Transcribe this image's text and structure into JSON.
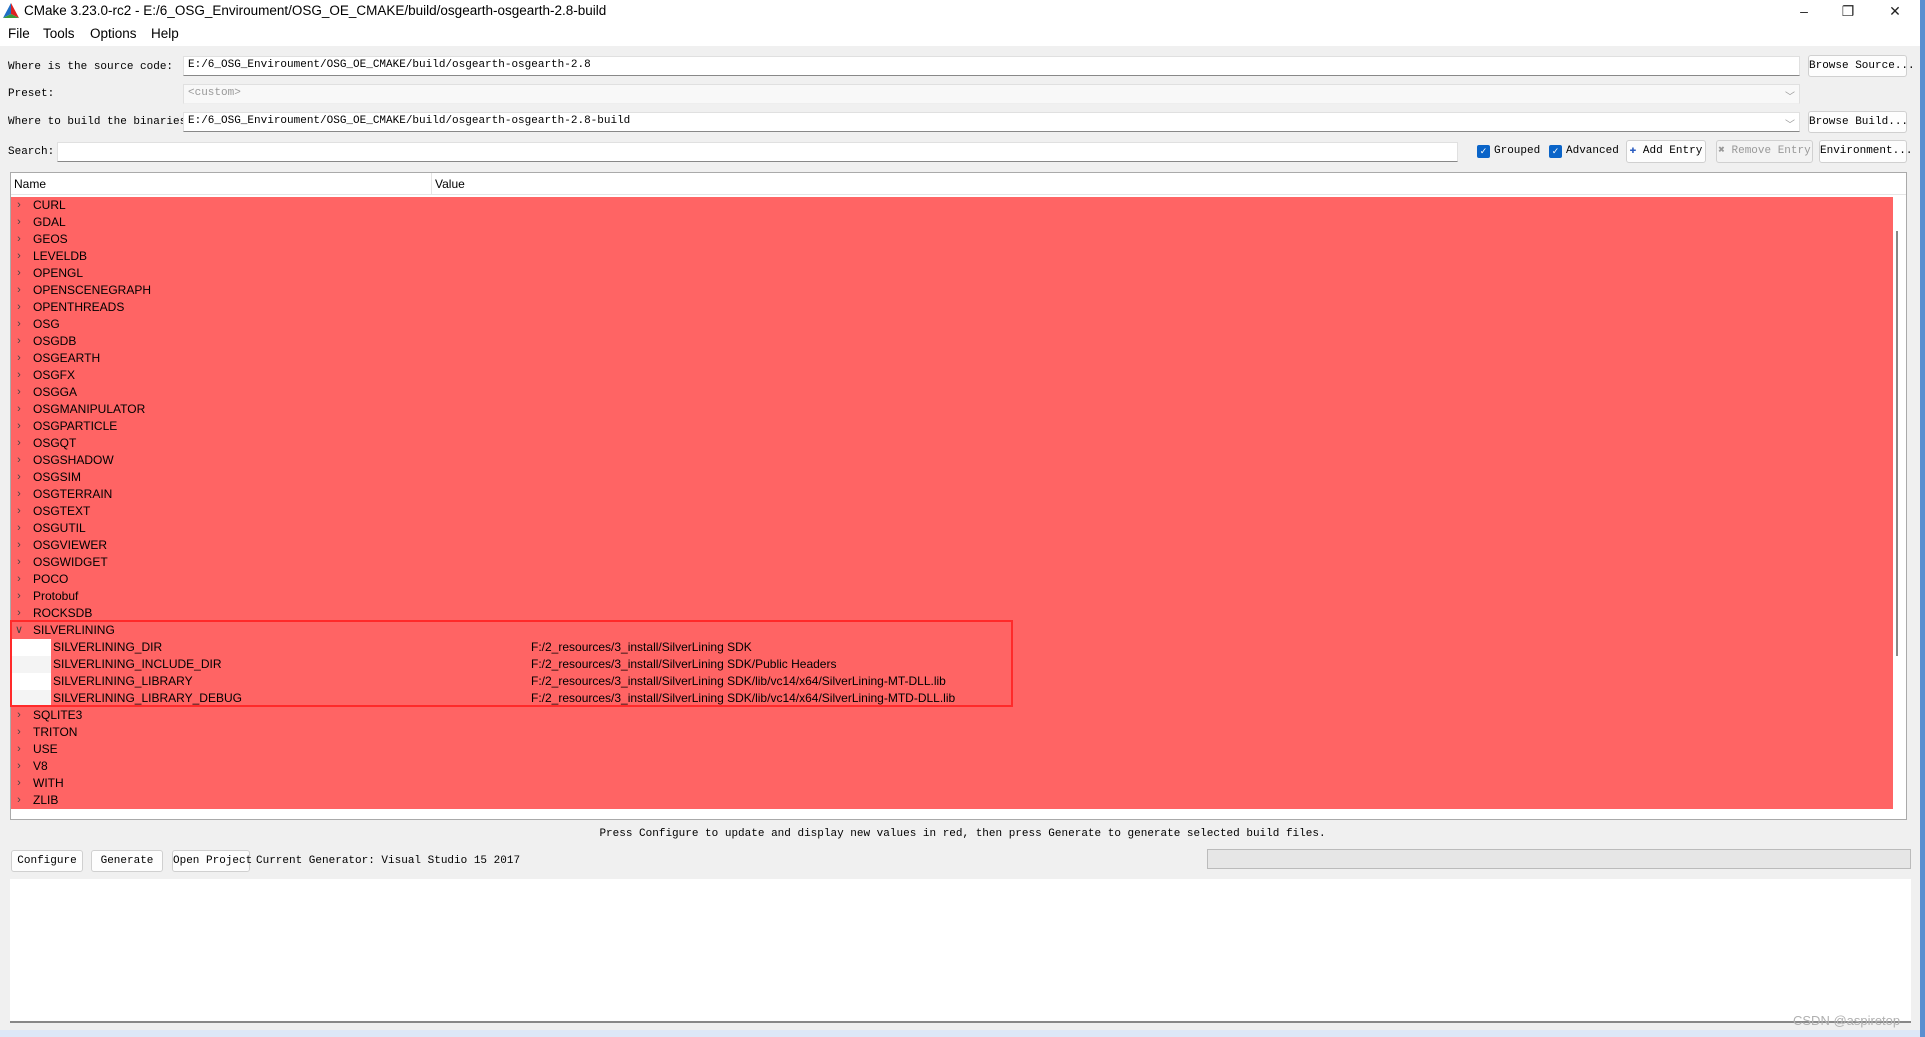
{
  "window": {
    "title": "CMake 3.23.0-rc2 - E:/6_OSG_Enviroument/OSG_OE_CMAKE/build/osgearth-osgearth-2.8-build",
    "minimize": "–",
    "maximize": "❐",
    "close": "✕"
  },
  "menu": [
    "File",
    "Tools",
    "Options",
    "Help"
  ],
  "source": {
    "label": "Where is the source code:",
    "value": "E:/6_OSG_Enviroument/OSG_OE_CMAKE/build/osgearth-osgearth-2.8",
    "button": "Browse Source..."
  },
  "preset": {
    "label": "Preset:",
    "value": "<custom>"
  },
  "build": {
    "label": "Where to build the binaries:",
    "value": "E:/6_OSG_Enviroument/OSG_OE_CMAKE/build/osgearth-osgearth-2.8-build",
    "button": "Browse Build..."
  },
  "search": {
    "label": "Search:",
    "value": ""
  },
  "toolbar": {
    "grouped": "Grouped",
    "grouped_checked": true,
    "advanced": "Advanced",
    "advanced_checked": true,
    "add_entry": "Add Entry",
    "remove_entry": "Remove Entry",
    "environment": "Environment..."
  },
  "table": {
    "headers": [
      "Name",
      "Value"
    ],
    "rows": [
      {
        "name": "CURL",
        "expanded": false
      },
      {
        "name": "GDAL",
        "expanded": false
      },
      {
        "name": "GEOS",
        "expanded": false
      },
      {
        "name": "LEVELDB",
        "expanded": false
      },
      {
        "name": "OPENGL",
        "expanded": false
      },
      {
        "name": "OPENSCENEGRAPH",
        "expanded": false
      },
      {
        "name": "OPENTHREADS",
        "expanded": false
      },
      {
        "name": "OSG",
        "expanded": false
      },
      {
        "name": "OSGDB",
        "expanded": false
      },
      {
        "name": "OSGEARTH",
        "expanded": false
      },
      {
        "name": "OSGFX",
        "expanded": false
      },
      {
        "name": "OSGGA",
        "expanded": false
      },
      {
        "name": "OSGMANIPULATOR",
        "expanded": false
      },
      {
        "name": "OSGPARTICLE",
        "expanded": false
      },
      {
        "name": "OSGQT",
        "expanded": false
      },
      {
        "name": "OSGSHADOW",
        "expanded": false
      },
      {
        "name": "OSGSIM",
        "expanded": false
      },
      {
        "name": "OSGTERRAIN",
        "expanded": false
      },
      {
        "name": "OSGTEXT",
        "expanded": false
      },
      {
        "name": "OSGUTIL",
        "expanded": false
      },
      {
        "name": "OSGVIEWER",
        "expanded": false
      },
      {
        "name": "OSGWIDGET",
        "expanded": false
      },
      {
        "name": "POCO",
        "expanded": false
      },
      {
        "name": "Protobuf",
        "expanded": false
      },
      {
        "name": "ROCKSDB",
        "expanded": false
      },
      {
        "name": "SILVERLINING",
        "expanded": true,
        "children": [
          {
            "name": "SILVERLINING_DIR",
            "value": "F:/2_resources/3_install/SilverLining SDK"
          },
          {
            "name": "SILVERLINING_INCLUDE_DIR",
            "value": "F:/2_resources/3_install/SilverLining SDK/Public Headers"
          },
          {
            "name": "SILVERLINING_LIBRARY",
            "value": "F:/2_resources/3_install/SilverLining SDK/lib/vc14/x64/SilverLining-MT-DLL.lib"
          },
          {
            "name": "SILVERLINING_LIBRARY_DEBUG",
            "value": "F:/2_resources/3_install/SilverLining SDK/lib/vc14/x64/SilverLining-MTD-DLL.lib"
          }
        ]
      },
      {
        "name": "SQLITE3",
        "expanded": false
      },
      {
        "name": "TRITON",
        "expanded": false
      },
      {
        "name": "USE",
        "expanded": false
      },
      {
        "name": "V8",
        "expanded": false
      },
      {
        "name": "WITH",
        "expanded": false
      },
      {
        "name": "ZLIB",
        "expanded": false
      }
    ]
  },
  "status": "Press Configure to update and display new values in red, then press Generate to generate selected build files.",
  "bottom": {
    "configure": "Configure",
    "generate": "Generate",
    "open_project": "Open Project",
    "generator": "Current Generator: Visual Studio 15 2017",
    "progress": 0
  },
  "watermark": "CSDN @aspiretop",
  "colors": {
    "changed_row": "#ff6464",
    "highlight_box": "#ff2a2a",
    "checkbox": "#0a64c8"
  }
}
